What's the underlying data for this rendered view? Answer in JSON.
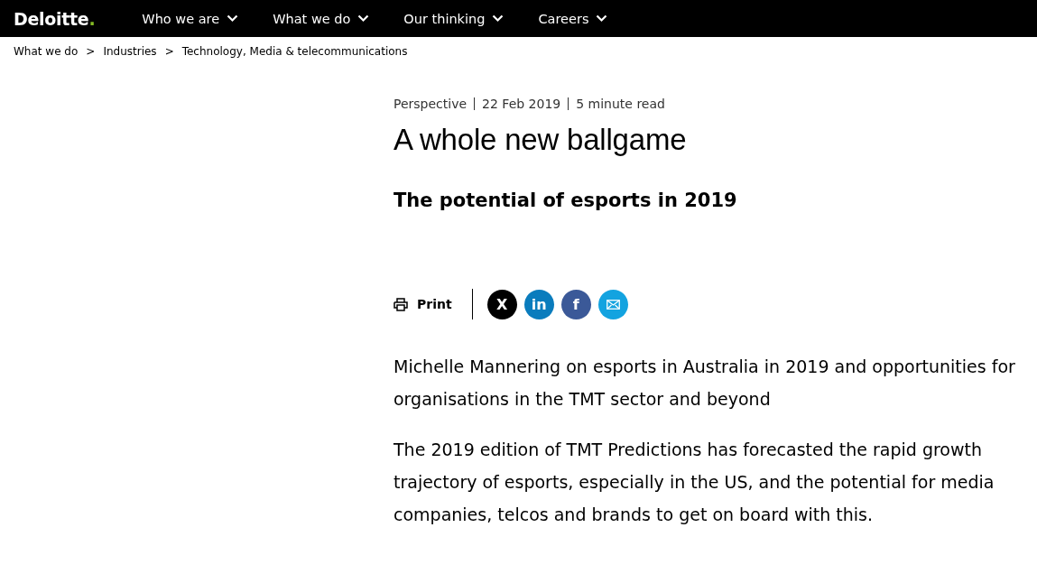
{
  "header": {
    "logo": {
      "name": "Deloitte",
      "mark": "."
    },
    "nav": [
      {
        "label": "Who we are",
        "expanded": false
      },
      {
        "label": "What we do",
        "expanded": false
      },
      {
        "label": "Our thinking",
        "expanded": false
      },
      {
        "label": "Careers",
        "expanded": false
      }
    ]
  },
  "breadcrumb": [
    {
      "label": "What we do",
      "separator": ">"
    },
    {
      "label": "Industries",
      "separator": ">"
    },
    {
      "label": "Technology, Media & telecommunications"
    }
  ],
  "meta": [
    "Perspective",
    "22 Feb 2019",
    "5 minute read"
  ],
  "title": "A whole new ballgame",
  "subtitle": "The potential of esports in 2019",
  "print": "Print",
  "share": [
    {
      "kind": "x",
      "label": "X",
      "color": "#000000"
    },
    {
      "kind": "linkedin",
      "label": "in",
      "color": "#0a7cbd"
    },
    {
      "kind": "facebook",
      "label": "f",
      "color": "#3b5998"
    },
    {
      "kind": "email",
      "color": "#13a3e0"
    }
  ],
  "paragraphs": [
    "Michelle Mannering on esports in Australia in 2019 and opportunities for organisations in the TMT sector and beyond",
    "The 2019 edition of TMT Predictions has forecasted the rapid growth trajectory of esports, especially in the US, and the potential for media companies, telcos and brands to get on board with this."
  ]
}
